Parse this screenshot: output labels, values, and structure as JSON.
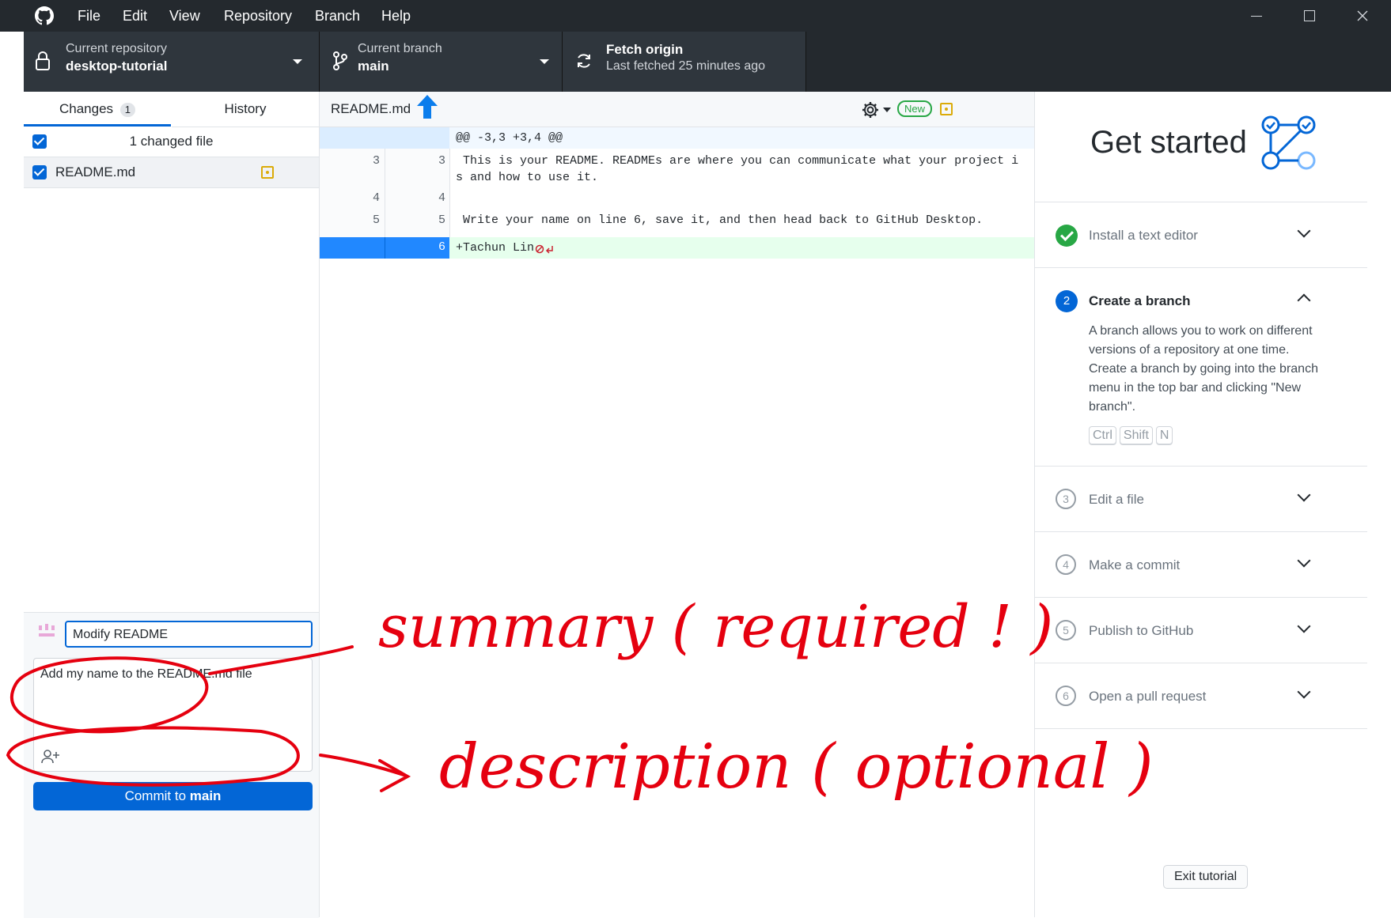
{
  "menu": [
    "File",
    "Edit",
    "View",
    "Repository",
    "Branch",
    "Help"
  ],
  "toolbar": {
    "repo_label": "Current repository",
    "repo_value": "desktop-tutorial",
    "branch_label": "Current branch",
    "branch_value": "main",
    "fetch_label": "Fetch origin",
    "fetch_sub": "Last fetched 25 minutes ago"
  },
  "left": {
    "tab_changes": "Changes",
    "tab_changes_count": "1",
    "tab_history": "History",
    "changed_files": "1 changed file",
    "file_name": "README.md",
    "summary_value": "Modify README",
    "description_value": "Add my name to the README.md file",
    "commit_prefix": "Commit to ",
    "commit_branch": "main"
  },
  "diff": {
    "file_name": "README.md",
    "new_badge": "New",
    "hunk_header": "@@ -3,3 +3,4 @@",
    "lines": [
      {
        "old": "3",
        "new": "3",
        "text": " This is your README. READMEs are where you can communicate what your project i",
        "text2": "s and how to use it."
      },
      {
        "old": "4",
        "new": "4",
        "text": ""
      },
      {
        "old": "5",
        "new": "5",
        "text": " Write your name on line 6, save it, and then head back to GitHub Desktop."
      },
      {
        "old": "",
        "new": "6",
        "text": "+Tachun Lin"
      }
    ]
  },
  "tutorial": {
    "title": "Get started",
    "steps": [
      {
        "num": "✓",
        "label": "Install a text editor"
      },
      {
        "num": "2",
        "label": "Create a branch",
        "desc": "A branch allows you to work on different versions of a repository at one time. Create a branch by going into the branch menu in the top bar and clicking \"New branch\".",
        "keys": [
          "Ctrl",
          "Shift",
          "N"
        ]
      },
      {
        "num": "3",
        "label": "Edit a file"
      },
      {
        "num": "4",
        "label": "Make a commit"
      },
      {
        "num": "5",
        "label": "Publish to GitHub"
      },
      {
        "num": "6",
        "label": "Open a pull request"
      }
    ],
    "exit": "Exit tutorial"
  },
  "annotations": {
    "summary_note": "summary ( required ! )",
    "description_note": "description ( optional )"
  }
}
